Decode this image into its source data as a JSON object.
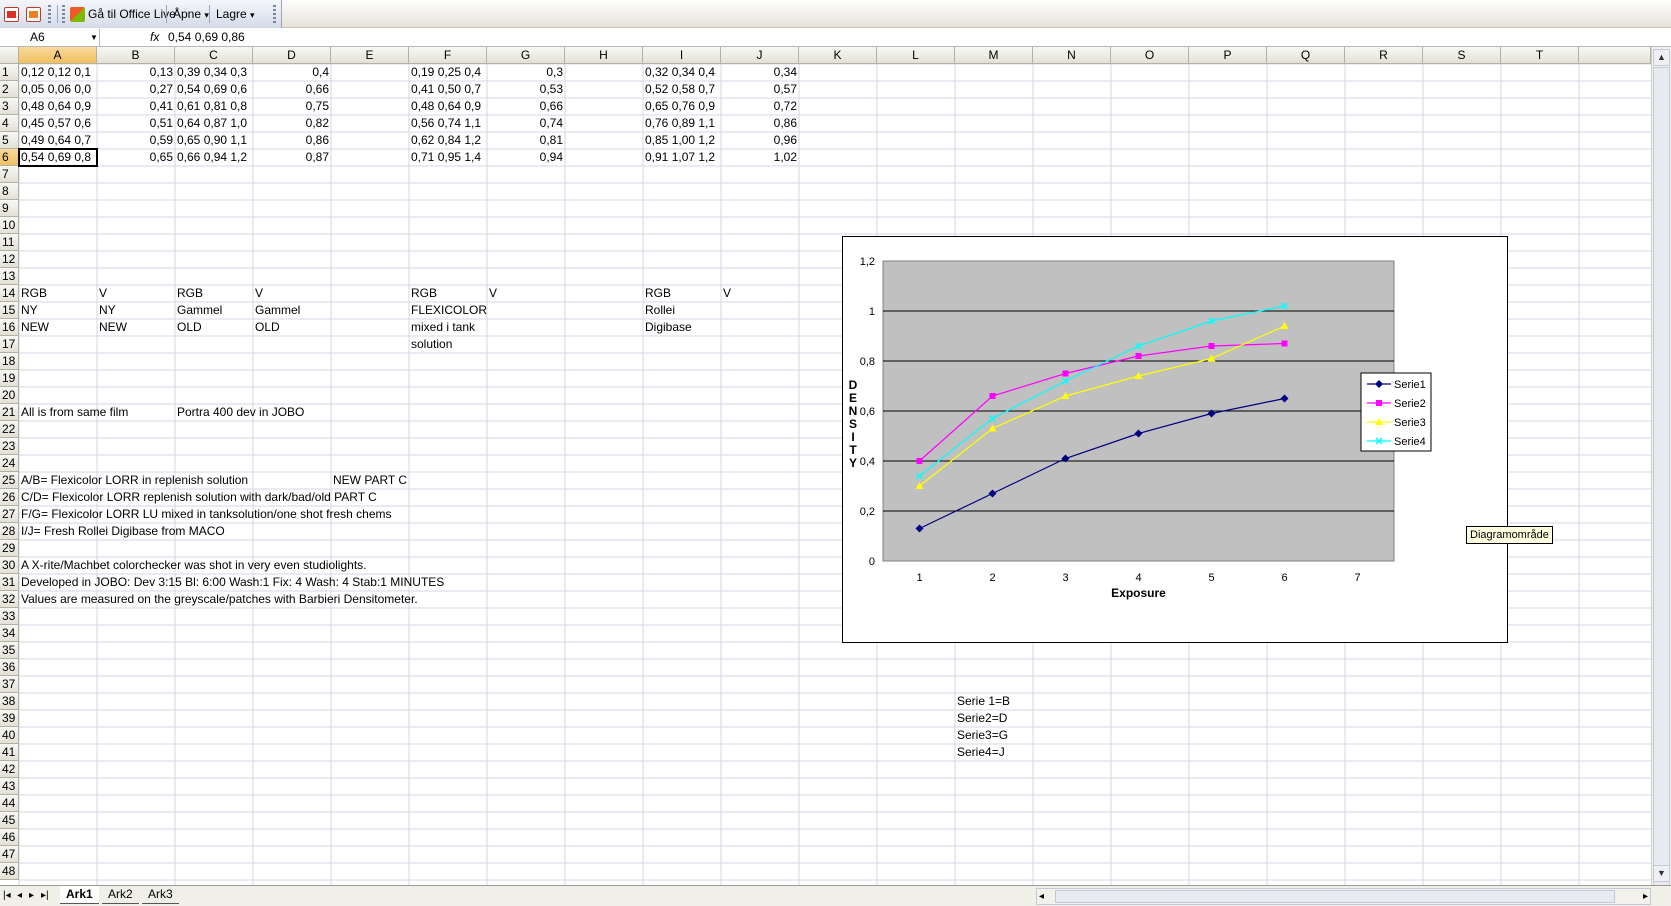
{
  "toolbar": {
    "office_live_label": "Gå til Office Live",
    "open_label": "Åpne",
    "save_label": "Lagre",
    "dropdown_arrow": "▾"
  },
  "formula_bar": {
    "name_box": "A6",
    "fx": "fx",
    "value": "0,54 0,69 0,86"
  },
  "columns": [
    "A",
    "B",
    "C",
    "D",
    "E",
    "F",
    "G",
    "H",
    "I",
    "J",
    "K",
    "L",
    "M",
    "N",
    "O",
    "P",
    "Q",
    "R",
    "S",
    "T"
  ],
  "rows": [
    "1",
    "2",
    "3",
    "4",
    "5",
    "6",
    "7",
    "8",
    "9",
    "10",
    "11",
    "12",
    "13",
    "14",
    "15",
    "16",
    "17",
    "18",
    "19",
    "20",
    "21",
    "22",
    "23",
    "24",
    "25",
    "26",
    "27",
    "28",
    "29",
    "30",
    "31",
    "32",
    "33",
    "34",
    "35",
    "36",
    "37",
    "38",
    "39",
    "40",
    "41",
    "42",
    "43",
    "44",
    "45",
    "46",
    "47",
    "48"
  ],
  "cells": {
    "A1": "0,12 0,12 0,1",
    "B1": "0,13",
    "C1": "0,39 0,34 0,3",
    "D1": "0,4",
    "F1": "0,19 0,25 0,4",
    "G1": "0,3",
    "I1": "0,32 0,34 0,4",
    "J1": "0,34",
    "A2": "0,05 0,06 0,0",
    "B2": "0,27",
    "C2": "0,54 0,69 0,6",
    "D2": "0,66",
    "F2": "0,41 0,50 0,7",
    "G2": "0,53",
    "I2": "0,52 0,58 0,7",
    "J2": "0,57",
    "A3": "0,48 0,64 0,9",
    "B3": "0,41",
    "C3": "0,61 0,81 0,8",
    "D3": "0,75",
    "F3": "0,48 0,64 0,9",
    "G3": "0,66",
    "I3": "0,65 0,76 0,9",
    "J3": "0,72",
    "A4": "0,45 0,57 0,6",
    "B4": "0,51",
    "C4": "0,64 0,87 1,0",
    "D4": "0,82",
    "F4": "0,56 0,74 1,1",
    "G4": "0,74",
    "I4": "0,76 0,89 1,1",
    "J4": "0,86",
    "A5": "0,49 0,64 0,7",
    "B5": "0,59",
    "C5": "0,65 0,90 1,1",
    "D5": "0,86",
    "F5": "0,62 0,84 1,2",
    "G5": "0,81",
    "I5": "0,85 1,00 1,2",
    "J5": "0,96",
    "A6": "0,54 0,69 0,8",
    "B6": "0,65",
    "C6": "0,66 0,94 1,2",
    "D6": "0,87",
    "F6": "0,71 0,95 1,4",
    "G6": "0,94",
    "I6": "0,91 1,07 1,2",
    "J6": "1,02",
    "A14": "RGB",
    "B14": "V",
    "C14": "RGB",
    "D14": "V",
    "F14": "RGB",
    "G14": "V",
    "I14": "RGB",
    "J14": "V",
    "A15": "NY",
    "B15": "NY",
    "C15": "Gammel",
    "D15": "Gammel",
    "F15": "FLEXICOLOR",
    "I15": "Rollei",
    "A16": "NEW",
    "B16": "NEW",
    "C16": "OLD",
    "D16": "OLD",
    "F16": "mixed i tank",
    "I16": "Digibase",
    "F17": "solution",
    "A21": "All is from same film",
    "C21": "Portra 400 dev in JOBO",
    "A25": "A/B= Flexicolor LORR in replenish solution",
    "E25": "NEW PART C",
    "A26": "C/D= Flexicolor LORR replenish solution with dark/bad/old PART C",
    "A27": "F/G= Flexicolor LORR LU mixed in tanksolution/one shot fresh chems",
    "A28": "I/J= Fresh Rollei Digibase from MACO",
    "A30": "A X-rite/Machbet colorchecker was shot in very even studiolights.",
    "A31": "Developed in JOBO: Dev 3:15 Bl: 6:00 Wash:1 Fix: 4 Wash: 4 Stab:1 MINUTES",
    "A32": "Values are measured on the greyscale/patches with Barbieri Densitometer.",
    "M38": "Serie 1=B",
    "M39": "Serie2=D",
    "M40": "Serie3=G",
    "M41": "Serie4=J"
  },
  "chart_data": {
    "type": "line",
    "x": [
      1,
      2,
      3,
      4,
      5,
      6
    ],
    "categories": [
      "1",
      "2",
      "3",
      "4",
      "5",
      "6",
      "7"
    ],
    "xlabel": "Exposure",
    "ylabel": "DENSITY",
    "ylim": [
      0,
      1.2
    ],
    "yticks": [
      "0",
      "0,2",
      "0,4",
      "0,6",
      "0,8",
      "1",
      "1,2"
    ],
    "grid": true,
    "legend_position": "right",
    "plot_background": "#c0c0c0",
    "series": [
      {
        "name": "Serie1",
        "values": [
          0.13,
          0.27,
          0.41,
          0.51,
          0.59,
          0.65
        ],
        "color": "#000080",
        "marker": "diamond"
      },
      {
        "name": "Serie2",
        "values": [
          0.4,
          0.66,
          0.75,
          0.82,
          0.86,
          0.87
        ],
        "color": "#ff00ff",
        "marker": "square"
      },
      {
        "name": "Serie3",
        "values": [
          0.3,
          0.53,
          0.66,
          0.74,
          0.81,
          0.94
        ],
        "color": "#ffff00",
        "marker": "triangle"
      },
      {
        "name": "Serie4",
        "values": [
          0.34,
          0.57,
          0.72,
          0.86,
          0.96,
          1.02
        ],
        "color": "#00ffff",
        "marker": "x"
      }
    ]
  },
  "tooltip": "Diagramområde",
  "sheet_tabs": [
    "Ark1",
    "Ark2",
    "Ark3"
  ],
  "active_sheet": "Ark1",
  "colors": {
    "active_header": "#f1c15f",
    "header": "#e3e1d6",
    "grid_line": "#d0d7e5"
  }
}
